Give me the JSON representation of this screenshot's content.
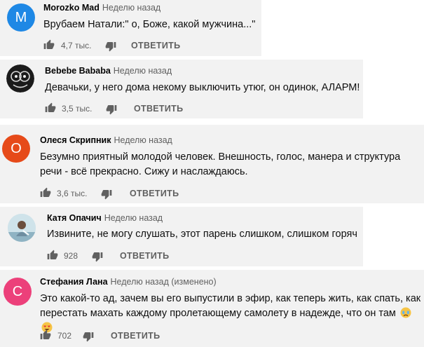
{
  "reply_label": "ОТВЕТИТЬ",
  "colors": {
    "card_bg": "#f2f2f2",
    "avatar_m": "#1e88e5",
    "avatar_o": "#e64a19",
    "avatar_s": "#ec407a",
    "icon": "#606060"
  },
  "comments": [
    {
      "author": "Morozko Mad",
      "time": "Неделю назад",
      "avatar_letter": "M",
      "text": "Врубаем Натали:\" о, Боже, какой мужчина...\"",
      "likes": "4,7 тыс."
    },
    {
      "author": "Bebebe Bababa",
      "time": "Неделю назад",
      "avatar_letter": "",
      "text": "Девачьки, у него дома некому выключить утюг, он одинок, АЛАРМ!",
      "likes": "3,5 тыс."
    },
    {
      "author": "Олеся Скрипник",
      "time": "Неделю назад",
      "avatar_letter": "О",
      "text": "Безумно приятный молодой человек. Внешность, голос, манера и структура речи - всё прекрасно. Сижу и наслаждаюсь.",
      "likes": "3,6 тыс."
    },
    {
      "author": "Катя Опачич",
      "time": "Неделю назад",
      "avatar_letter": "",
      "text": "Извините, не могу слушать, этот парень слишком, слишком горяч",
      "likes": "928"
    },
    {
      "author": "Стефания Лана",
      "time": "Неделю назад (изменено)",
      "avatar_letter": "C",
      "text": "Это какой-то ад, зачем вы его выпустили в эфир, как теперь жить, как спать, как перестать махать каждому пролетающему самолету в надежде, что он там",
      "likes": "702"
    }
  ]
}
